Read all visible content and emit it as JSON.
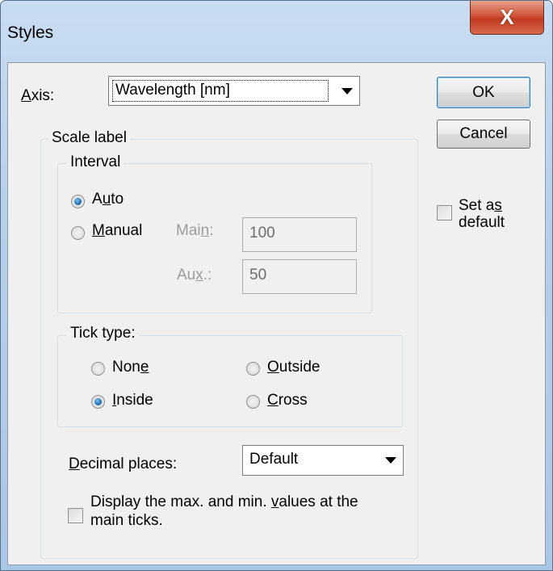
{
  "window": {
    "title": "Styles",
    "close_label": "X"
  },
  "axis": {
    "label_prefix": "",
    "label_key": "A",
    "label_rest": "xis:",
    "selected": "Wavelength [nm]"
  },
  "buttons": {
    "ok": "OK",
    "cancel": "Cancel"
  },
  "set_default": {
    "line1_pre": "Set a",
    "line1_key": "s",
    "line2": "default",
    "checked": false
  },
  "scale_label": {
    "title": "Scale label"
  },
  "interval": {
    "title": "Interval",
    "auto": {
      "pre": "A",
      "key": "u",
      "post": "to",
      "selected": true
    },
    "manual": {
      "pre": "",
      "key": "M",
      "post": "anual",
      "selected": false
    },
    "main": {
      "pre": "Mai",
      "key": "n",
      "post": ":",
      "value": "100"
    },
    "aux": {
      "pre": "Au",
      "key": "x",
      "post": ".:",
      "value": "50"
    }
  },
  "tick_type": {
    "title": "Tick type:",
    "none": {
      "pre": "Non",
      "key": "e",
      "post": "",
      "selected": false
    },
    "outside": {
      "pre": "",
      "key": "O",
      "post": "utside",
      "selected": false
    },
    "inside": {
      "pre": "",
      "key": "I",
      "post": "nside",
      "selected": true
    },
    "cross": {
      "pre": "",
      "key": "C",
      "post": "ross",
      "selected": false
    }
  },
  "decimal_places": {
    "pre": "",
    "key": "D",
    "post": "ecimal places:",
    "selected": "Default"
  },
  "display_maxmin": {
    "line1_pre": "Display the max. and min. ",
    "line1_key": "v",
    "line1_post": "alues at the",
    "line2": "main ticks.",
    "checked": false
  },
  "colors": {
    "accent": "#1e6fb5",
    "close": "#c13a20",
    "background": "#f0f0f0"
  },
  "icons": [
    "close-icon",
    "dropdown-arrow-icon"
  ]
}
